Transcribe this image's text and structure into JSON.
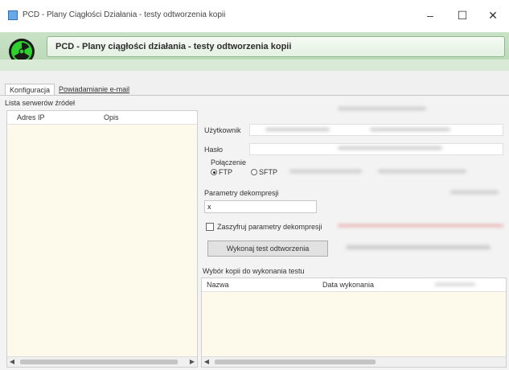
{
  "window": {
    "title": "PCD - Plany Ciągłości Działania - testy odtworzenia kopii",
    "minimize": "–",
    "maximize": "☐",
    "close": "✕"
  },
  "banner": {
    "title": "PCD - Plany ciągłości działania - testy odtworzenia kopii"
  },
  "tabs": [
    {
      "label": "Konfiguracja"
    },
    {
      "label": "Powiadamianie e-mail"
    }
  ],
  "servers": {
    "title": "Lista serwerów źródeł",
    "columns": [
      "Adres IP",
      "Opis"
    ]
  },
  "form": {
    "user_label": "Użytkownik",
    "password_label": "Hasło",
    "connection_label": "Połączenie",
    "ftp_label": "FTP",
    "sftp_label": "SFTP",
    "params_label": "Parametry dekompresji",
    "params_value": "x",
    "checkbox_label": "Zaszyfruj parametry dekompresji",
    "run_button": "Wykonaj test odtworzenia"
  },
  "copies": {
    "title": "Wybór kopii do wykonania testu",
    "columns": [
      "Nazwa",
      "Data wykonania"
    ]
  },
  "colors": {
    "banner": "#c9e2c7",
    "grid_bg": "#fdfaeb"
  }
}
